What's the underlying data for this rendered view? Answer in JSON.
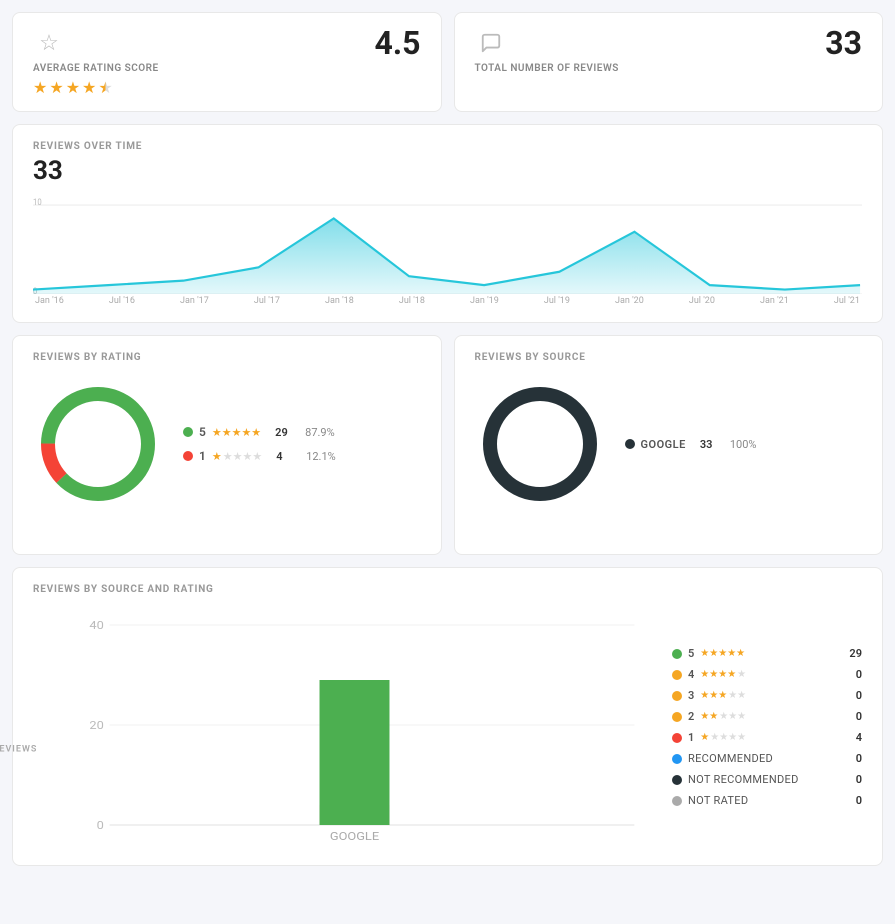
{
  "topCards": [
    {
      "id": "avg-rating",
      "label": "AVERAGE RATING SCORE",
      "value": "4.5",
      "icon": "star",
      "stars": [
        true,
        true,
        true,
        true,
        "half"
      ]
    },
    {
      "id": "total-reviews",
      "label": "TOTAL NUMBER OF REVIEWS",
      "value": "33",
      "icon": "chat",
      "stars": []
    }
  ],
  "reviewsOverTime": {
    "sectionTitle": "REVIEWS OVER TIME",
    "count": "33",
    "xLabels": [
      "Jan '16",
      "Jul '16",
      "Jan '17",
      "Jul '17",
      "Jan '18",
      "Jul '18",
      "Jan '19",
      "Jul '19",
      "Jan '20",
      "Jul '20",
      "Jan '21",
      "Jul '21"
    ],
    "yMax": 10,
    "points": [
      [
        0,
        0.5
      ],
      [
        1,
        1
      ],
      [
        2,
        1.5
      ],
      [
        3,
        3
      ],
      [
        4,
        8.5
      ],
      [
        5,
        2
      ],
      [
        6,
        1
      ],
      [
        7,
        2.5
      ],
      [
        8,
        7
      ],
      [
        9,
        1
      ],
      [
        10,
        0.5
      ],
      [
        11,
        1
      ]
    ]
  },
  "reviewsByRating": {
    "sectionTitle": "REVIEWS BY RATING",
    "donut": {
      "segments": [
        {
          "color": "#4caf50",
          "pct": 87.9
        },
        {
          "color": "#f44336",
          "pct": 12.1
        }
      ]
    },
    "legend": [
      {
        "dot": "#4caf50",
        "stars": 5,
        "count": 29,
        "pct": "87.9%"
      },
      {
        "dot": "#f44336",
        "stars": 1,
        "count": 4,
        "pct": "12.1%"
      }
    ]
  },
  "reviewsBySource": {
    "sectionTitle": "REVIEWS BY SOURCE",
    "donut": {
      "segments": [
        {
          "color": "#263238",
          "pct": 100
        }
      ]
    },
    "legend": [
      {
        "dot": "#263238",
        "label": "GOOGLE",
        "count": 33,
        "pct": "100%"
      }
    ]
  },
  "reviewsBySourceAndRating": {
    "sectionTitle": "REVIEWS BY SOURCE AND RATING",
    "yAxisLabel": "REVIEWS",
    "yLabels": [
      "0",
      "20",
      "40"
    ],
    "bar": {
      "label": "GOOGLE",
      "total": 33,
      "segments": [
        {
          "color": "#4caf50",
          "value": 29
        },
        {
          "color": "#f44336",
          "value": 4
        }
      ]
    },
    "legend": [
      {
        "dot": "#4caf50",
        "stars": 5,
        "starsFilled": 5,
        "label": "5",
        "count": 29
      },
      {
        "dot": "#f5a623",
        "stars": 4,
        "starsFilled": 4,
        "label": "4",
        "count": 0
      },
      {
        "dot": "#f5a623",
        "stars": 3,
        "starsFilled": 3,
        "label": "3",
        "count": 0
      },
      {
        "dot": "#f5a623",
        "stars": 2,
        "starsFilled": 2,
        "label": "2",
        "count": 0
      },
      {
        "dot": "#f44336",
        "stars": 1,
        "starsFilled": 1,
        "label": "1",
        "count": 4
      },
      {
        "dot": "#2196f3",
        "label": "RECOMMENDED",
        "count": 0
      },
      {
        "dot": "#263238",
        "label": "NOT RECOMMENDED",
        "count": 0
      },
      {
        "dot": "#aaa",
        "label": "NOT RATED",
        "count": 0
      }
    ]
  }
}
